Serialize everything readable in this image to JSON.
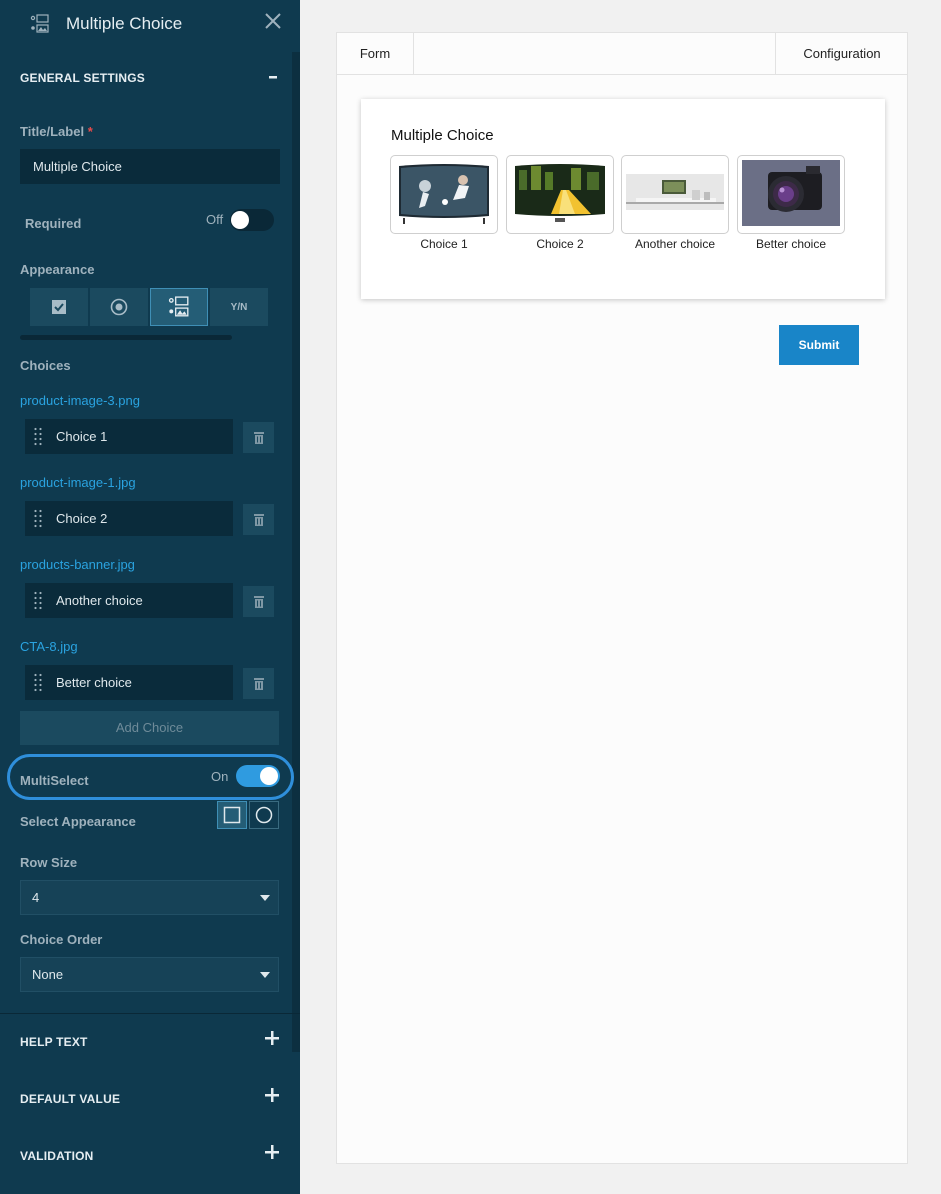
{
  "header": {
    "title": "Multiple Choice"
  },
  "sections": {
    "general": {
      "title": "GENERAL SETTINGS",
      "toggle": "−"
    },
    "help": {
      "title": "HELP TEXT"
    },
    "default": {
      "title": "DEFAULT VALUE"
    },
    "validation": {
      "title": "VALIDATION"
    }
  },
  "title_field": {
    "label": "Title/Label",
    "required_marker": "*",
    "value": "Multiple Choice"
  },
  "required": {
    "label": "Required",
    "state": "Off"
  },
  "appearance": {
    "label": "Appearance",
    "options": [
      "checkbox-icon",
      "radio-icon",
      "image-choice-icon",
      "Y/N"
    ],
    "selected_index": 2
  },
  "choices": {
    "label": "Choices",
    "items": [
      {
        "file": "product-image-3.png",
        "label": "Choice 1"
      },
      {
        "file": "product-image-1.jpg",
        "label": "Choice 2"
      },
      {
        "file": "products-banner.jpg",
        "label": "Another choice"
      },
      {
        "file": "CTA-8.jpg",
        "label": "Better choice"
      }
    ],
    "add_label": "Add Choice"
  },
  "multiselect": {
    "label": "MultiSelect",
    "state": "On"
  },
  "select_appearance": {
    "label": "Select Appearance",
    "options": [
      "square-icon",
      "circle-icon"
    ],
    "selected_index": 0
  },
  "row_size": {
    "label": "Row Size",
    "value": "4"
  },
  "choice_order": {
    "label": "Choice Order",
    "value": "None"
  },
  "tabs": {
    "form": "Form",
    "configuration": "Configuration"
  },
  "preview": {
    "title": "Multiple Choice",
    "tiles": [
      {
        "label": "Choice 1",
        "image": "tv-soccer-image"
      },
      {
        "label": "Choice 2",
        "image": "tv-city-image"
      },
      {
        "label": "Another choice",
        "image": "living-room-image"
      },
      {
        "label": "Better choice",
        "image": "camera-image"
      }
    ],
    "submit": "Submit"
  },
  "colors": {
    "sidebar": "#0f3a4f",
    "accent": "#2aa3e0",
    "submit": "#1985c8",
    "toggle_on": "#2f9be0"
  }
}
